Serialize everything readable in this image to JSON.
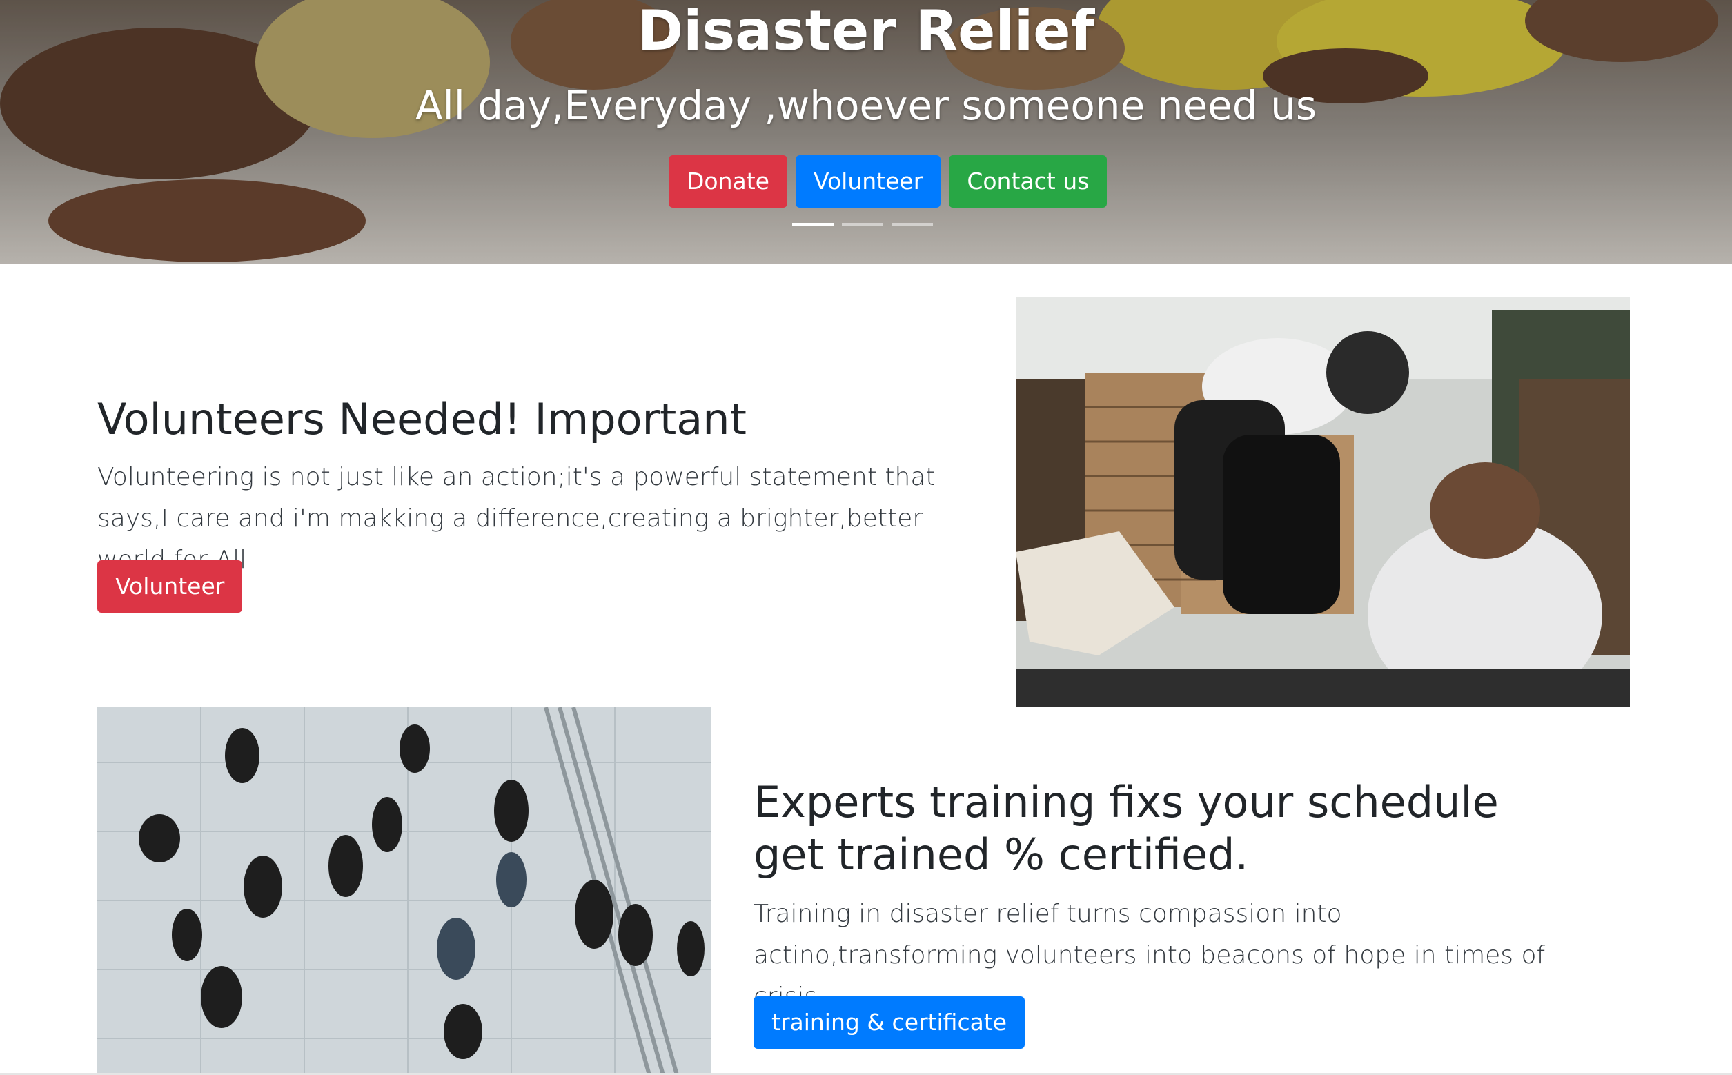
{
  "hero": {
    "title": "Disaster Relief",
    "subtitle": "All day,Everyday ,whoever someone need us",
    "buttons": {
      "donate": "Donate",
      "volunteer": "Volunteer",
      "contact": "Contact us"
    },
    "slides": {
      "count": 3,
      "active": 1
    }
  },
  "volunteer_section": {
    "title": "Volunteers Needed! Important",
    "text": "Volunteering is not just like an action;it's a powerful statement that says,I care and i'm makking a difference,creating a brighter,better world for All",
    "button": "Volunteer"
  },
  "training_section": {
    "title": "Experts training fixs your schedule get trained % certified.",
    "text": "Training in disaster relief turns compassion into actino,transforming volunteers into beacons of hope in times of crisis.",
    "button": "training & certificate"
  },
  "colors": {
    "red": "#dc3545",
    "blue": "#007bff",
    "green": "#28a745"
  }
}
